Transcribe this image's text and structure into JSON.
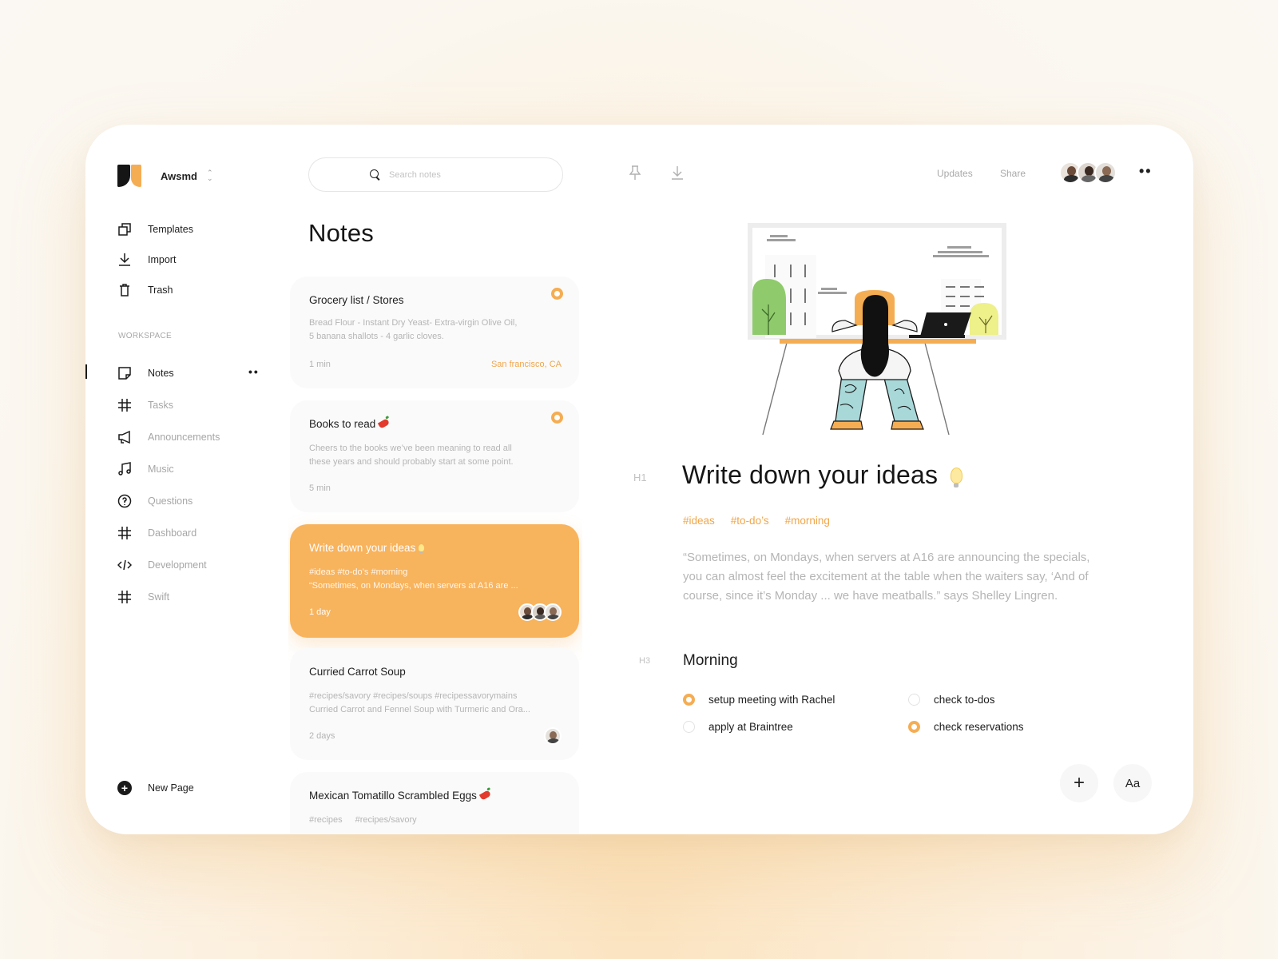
{
  "brand": {
    "name": "Awsmd",
    "switch_icon": "chevron-updown-icon"
  },
  "sidebar": {
    "top_items": [
      {
        "label": "Templates",
        "icon": "templates-icon"
      },
      {
        "label": "Import",
        "icon": "import-icon"
      },
      {
        "label": "Trash",
        "icon": "trash-icon"
      }
    ],
    "workspace_label": "WORKSPACE",
    "items": [
      {
        "label": "Notes",
        "icon": "note-icon",
        "active": true
      },
      {
        "label": "Tasks",
        "icon": "hash-icon"
      },
      {
        "label": "Announcements",
        "icon": "megaphone-icon"
      },
      {
        "label": "Music",
        "icon": "music-icon"
      },
      {
        "label": "Questions",
        "icon": "question-icon"
      },
      {
        "label": "Dashboard",
        "icon": "hash-icon"
      },
      {
        "label": "Development",
        "icon": "code-icon"
      },
      {
        "label": "Swift",
        "icon": "hash-icon"
      }
    ],
    "new_page": "New Page"
  },
  "search": {
    "placeholder": "Search notes"
  },
  "notes": {
    "title": "Notes",
    "cards": [
      {
        "title": "Grocery list / Stores",
        "body1": "Bread Flour - Instant Dry Yeast- Extra-virgin Olive Oil,",
        "body2": "5 banana shallots - 4 garlic cloves.",
        "meta": "1 min",
        "location": "San francisco, CA"
      },
      {
        "title": "Books to read",
        "body1": "Cheers to the books we’ve been meaning to read all",
        "body2": "these years and should probably start at some point.",
        "meta": "5 min"
      },
      {
        "title": "Write down your ideas",
        "body1": "#ideas #to-do’s #morning",
        "body2": "“Sometimes, on Mondays, when servers at A16 are ...",
        "meta": "1 day"
      },
      {
        "title": "Curried Carrot Soup",
        "body1": "#recipes/savory #recipes/soups #recipessavorymains",
        "body2": "Curried Carrot and Fennel Soup with Turmeric and Ora...",
        "meta": "2 days"
      },
      {
        "title": "Mexican Tomatillo Scrambled Eggs",
        "tag1": "#recipes",
        "tag2": "#recipes/savory"
      }
    ]
  },
  "toolbar": {
    "updates": "Updates",
    "share": "Share"
  },
  "doc": {
    "h1_label": "H1",
    "title": "Write down your ideas",
    "tags": [
      "#ideas",
      "#to-do’s",
      "#morning"
    ],
    "quote": "“Sometimes, on Mondays, when servers at A16 are announcing the specials, you can almost feel the excitement at the table when the waiters say, ‘And of course, since it’s Monday ... we have meatballs.” says Shelley Lingren.",
    "h3_label": "H3",
    "section_title": "Morning",
    "todos": [
      {
        "label": "setup meeting with Rachel",
        "checked": true
      },
      {
        "label": "check to-dos",
        "checked": false
      },
      {
        "label": "apply at Braintree",
        "checked": false
      },
      {
        "label": "check reservations",
        "checked": true
      }
    ]
  },
  "actions": {
    "add": "+",
    "font": "Aa"
  },
  "colors": {
    "accent": "#f5ad53",
    "accent_text": "#f0a64b",
    "muted": "#b5b5b5"
  }
}
